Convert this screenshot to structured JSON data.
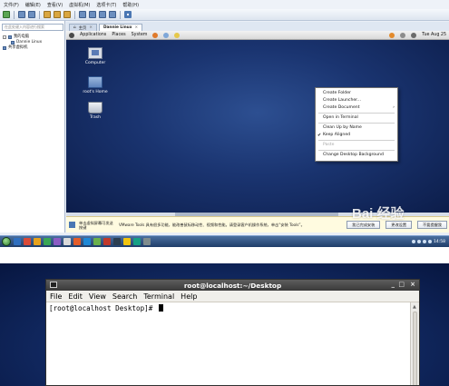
{
  "vmware": {
    "menu": [
      "文件(F)",
      "编辑(E)",
      "查看(V)",
      "虚拟机(M)",
      "选项卡(T)",
      "帮助(H)"
    ],
    "search_placeholder": "在此处键入内容进行搜索",
    "tree": {
      "root": "我的电脑",
      "vm": "Dannie Linux",
      "shared": "共享虚拟机"
    },
    "tabs": [
      {
        "label": "主页",
        "active": false
      },
      {
        "label": "Dannie Linux",
        "active": true
      }
    ],
    "notice": {
      "left": "单击虚拟屏幕可发送按键",
      "text": "VMware Tools 具有很多功能，能改善鼠标移动性、视频和性能。请登录客户机操作系统，单击“安装 Tools”。",
      "buttons": [
        "我已完成安装",
        "更改设置",
        "不要提醒我"
      ]
    },
    "watermark": "Bai 经验"
  },
  "guest": {
    "panel": {
      "menus": [
        "Applications",
        "Places",
        "System"
      ],
      "clock": "Tue Aug 25"
    },
    "desktop_icons": [
      {
        "label": "Computer",
        "icon": "computer-icon"
      },
      {
        "label": "root's Home",
        "icon": "home-folder-icon"
      },
      {
        "label": "Trash",
        "icon": "trash-icon"
      }
    ],
    "context_menu": {
      "create_folder": "Create Folder",
      "create_launcher": "Create Launcher...",
      "create_document": "Create Document",
      "open_in_terminal": "Open in Terminal",
      "clean_up": "Clean Up by Name",
      "keep_aligned": "Keep Aligned",
      "keep_aligned_checked": true,
      "paste": "Paste",
      "change_background": "Change Desktop Background"
    }
  },
  "taskbar": {
    "clock": "14:58"
  },
  "terminal": {
    "title": "root@localhost:~/Desktop",
    "controls": [
      "_",
      "□",
      "×"
    ],
    "menu": [
      "File",
      "Edit",
      "View",
      "Search",
      "Terminal",
      "Help"
    ],
    "prompt": "[root@localhost Desktop]# "
  }
}
